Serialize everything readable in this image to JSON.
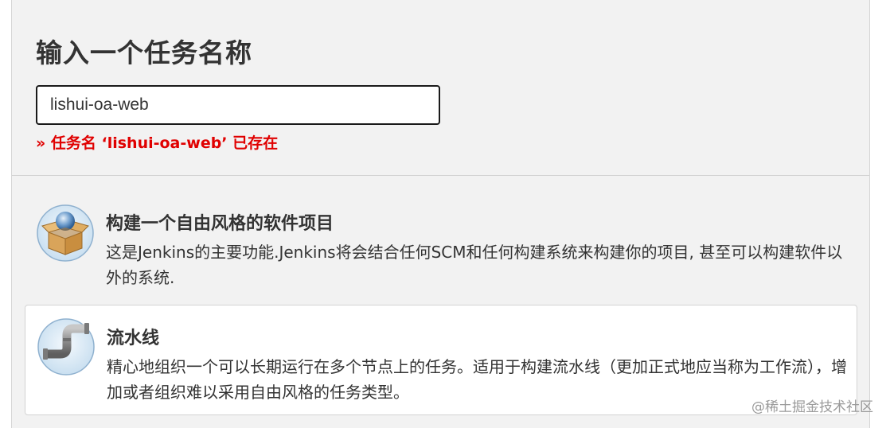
{
  "header": {
    "title": "输入一个任务名称",
    "input_value": "lishui-oa-web",
    "error": "» 任务名 ‘lishui-oa-web’ 已存在"
  },
  "items": [
    {
      "icon": "freestyle-project-box-icon",
      "title": "构建一个自由风格的软件项目",
      "description": "这是Jenkins的主要功能.Jenkins将会结合任何SCM和任何构建系统来构建你的项目, 甚至可以构建软件以外的系统."
    },
    {
      "icon": "pipeline-pipe-icon",
      "title": "流水线",
      "description": "精心地组织一个可以长期运行在多个节点上的任务。适用于构建流水线（更加正式地应当称为工作流），增加或者组织难以采用自由风格的任务类型。"
    }
  ],
  "watermark": "@稀土掘金技术社区",
  "colors": {
    "error": "#e00000",
    "panel_bg": "#f2f2f2",
    "input_border": "#1a1a1a"
  }
}
